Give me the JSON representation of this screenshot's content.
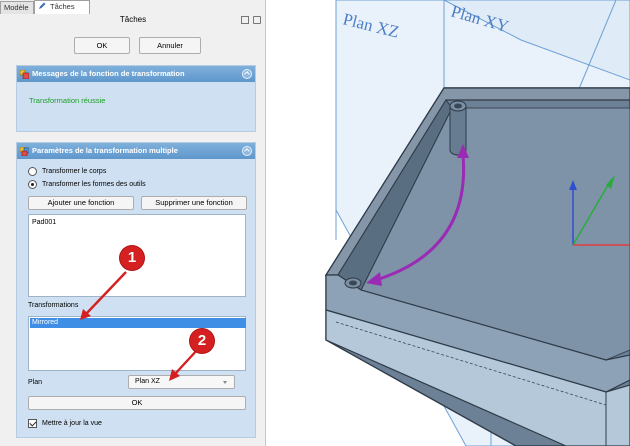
{
  "tabs": [
    {
      "label": "Modèle"
    },
    {
      "label": "Tâches"
    }
  ],
  "panel": {
    "title": "Tâches",
    "ok_label": "OK",
    "cancel_label": "Annuler"
  },
  "messages_box": {
    "title": "Messages de la fonction de transformation",
    "message": "Transformation réussie",
    "message_color": "#1a9f26"
  },
  "params_box": {
    "title": "Paramètres de la transformation multiple",
    "radio_options": [
      {
        "label": "Transformer le corps",
        "checked": false
      },
      {
        "label": "Transformer les formes des outils",
        "checked": true
      }
    ],
    "add_feature_label": "Ajouter une fonction",
    "remove_feature_label": "Supprimer une fonction",
    "features": [
      "Pad001"
    ],
    "transformations_label": "Transformations",
    "transformations": [
      {
        "label": "Mirrored",
        "selected": true
      }
    ],
    "plane_label": "Plan",
    "plane_value": "Plan XZ",
    "ok_label": "OK",
    "update_view_label": "Mettre à jour la vue",
    "update_view_checked": true
  },
  "annotations": {
    "badge_1": "1",
    "badge_2": "2",
    "badge_color": "#d42020"
  },
  "viewport": {
    "plane_labels": [
      "Plan XZ",
      "Plan XY"
    ],
    "plane_color": "#4d7fc4",
    "arrow_color": "#9a2bb4",
    "axis_colors": {
      "x": "#e03c3c",
      "y": "#2bab3c",
      "z": "#2f4fcf"
    }
  }
}
